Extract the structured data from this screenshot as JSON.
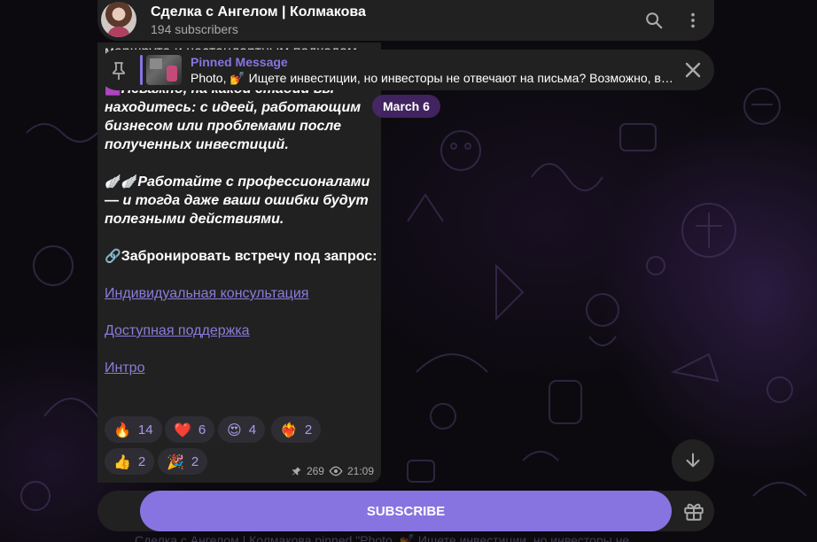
{
  "header": {
    "title": "Сделка с Ангелом | Колмакова",
    "subscribers": "194 subscribers",
    "search_icon": "search-icon",
    "menu_icon": "more-vertical-icon"
  },
  "pinned": {
    "title": "Pinned Message",
    "text": "Photo, 💅 Ищете инвестиции, но инвесторы не отвечают на письма? Возможно, в…",
    "pin_icon": "pin-icon",
    "close_icon": "close-icon"
  },
  "date_separator": "March 6",
  "message": {
    "cut_line": "маршрута и нестандартным подходом.",
    "para1_emoji": "🟪",
    "para1": "Неважно, на какой стадии вы находитесь: с идеей, работающим бизнесом или проблемами после полученных инвестиций.",
    "para2_emoji": "🪽🪽",
    "para2": "Работайте с профессионалами — и тогда даже ваши ошибки будут полезными действиями.",
    "para3_emoji": "🔗",
    "para3": "Забронировать  встречу под запрос:",
    "link1": "Индивидуальная консультация",
    "link2": "Доступная поддержка",
    "link3": "Интро",
    "reactions": [
      {
        "emoji": "🔥",
        "count": "14"
      },
      {
        "emoji": "❤️",
        "count": "6"
      },
      {
        "emoji": "😍",
        "count": "4"
      },
      {
        "emoji": "❤️‍🔥",
        "count": "2"
      },
      {
        "emoji": "👍",
        "count": "2"
      },
      {
        "emoji": "🎉",
        "count": "2"
      }
    ],
    "views": "269",
    "time": "21:09"
  },
  "footer": {
    "subscribe_label": "SUBSCRIBE",
    "gift_icon": "gift-icon",
    "ghost_text": "Сделка с Ангелом | Колмакова pinned \"Photo, 💅 Ищете инвестиции, но инвесторы не"
  },
  "colors": {
    "accent": "#8774e1",
    "panel": "#212121",
    "date_pill": "#4b286e"
  }
}
